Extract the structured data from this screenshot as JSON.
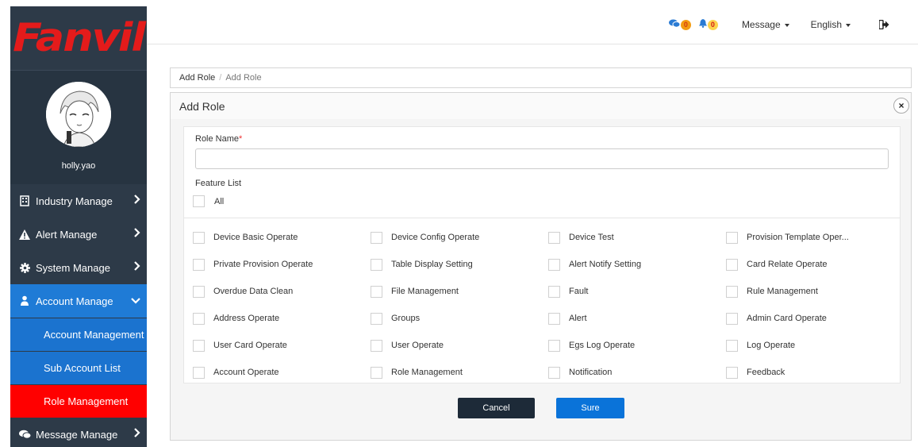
{
  "logo": {
    "text": "Fanvil"
  },
  "profile": {
    "username": "holly.yao"
  },
  "sidebar": {
    "items": [
      {
        "label": "Industry Manage",
        "icon": "building-icon"
      },
      {
        "label": "Alert Manage",
        "icon": "alert-icon"
      },
      {
        "label": "System Manage",
        "icon": "gear-icon"
      },
      {
        "label": "Account Manage",
        "icon": "users-icon"
      }
    ],
    "subitems": [
      {
        "label": "Account Management"
      },
      {
        "label": "Sub Account List"
      },
      {
        "label": "Role Management"
      }
    ],
    "last": {
      "label": "Message Manage",
      "icon": "comments-icon"
    }
  },
  "topbar": {
    "messages_count": "0",
    "alerts_count": "0",
    "message_label": "Message",
    "language_label": "English"
  },
  "breadcrumb": {
    "parent": "Add Role",
    "separator": "/",
    "current": "Add Role"
  },
  "panel": {
    "title": "Add Role",
    "close_label": "×",
    "role_name_label": "Role Name",
    "required_mark": "*",
    "role_name_value": "",
    "feature_list_label": "Feature List",
    "all_label": "All",
    "features": [
      "Device Basic Operate",
      "Device Config Operate",
      "Device Test",
      "Provision Template Oper...",
      "Private Provision Operate",
      "Table Display Setting",
      "Alert Notify Setting",
      "Card Relate Operate",
      "Overdue Data Clean",
      "File Management",
      "Fault",
      "Rule Management",
      "Address Operate",
      "Groups",
      "Alert",
      "Admin Card Operate",
      "User Card Operate",
      "User Operate",
      "Egs Log Operate",
      "Log Operate",
      "Account Operate",
      "Role Management",
      "Notification",
      "Feedback"
    ],
    "cancel_label": "Cancel",
    "sure_label": "Sure"
  },
  "colors": {
    "sidebar_bg": "#2d3a48",
    "active_blue": "#1b73cf",
    "role_red": "#ff0000",
    "sure_blue": "#0a73d9",
    "cancel_dark": "#1d2a38"
  }
}
